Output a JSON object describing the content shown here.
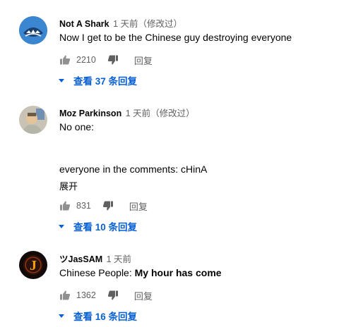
{
  "comments": [
    {
      "author": "Not A Shark",
      "time": "1 天前（修改过）",
      "text_plain": "Now I get to be the Chinese guy destroying everyone",
      "likes": "2210",
      "reply_label": "回复",
      "view_replies": "查看 37 条回复",
      "avatar_icon": "shark-avatar"
    },
    {
      "author": "Moz Parkinson",
      "time": "1 天前（修改过）",
      "text_line1": "No one:",
      "text_line2": "everyone in the comments: cHinA",
      "expand_label": "展开",
      "likes": "831",
      "reply_label": "回复",
      "view_replies": "查看 10 条回复",
      "avatar_icon": "person-avatar"
    },
    {
      "author": "ツJasSAM",
      "time": "1 天前",
      "text_prefix": "Chinese People: ",
      "text_bold": "My hour has come",
      "likes": "1362",
      "reply_label": "回复",
      "view_replies": "查看 16 条回复",
      "avatar_icon": "j-logo-avatar",
      "avatar_letter": "J"
    }
  ],
  "colors": {
    "link_blue": "#065fd4",
    "meta_gray": "#606060",
    "text": "#030303"
  }
}
